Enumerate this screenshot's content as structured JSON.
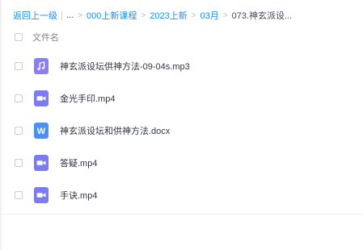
{
  "breadcrumb": {
    "back_label": "返回上一级",
    "ellipsis": "...",
    "items": [
      "000上新课程",
      "2023上新",
      "03月"
    ],
    "current": "073.神玄派设...",
    "arrow": ">"
  },
  "table": {
    "header": {
      "name_column": "文件名"
    },
    "files": [
      {
        "name": "神玄派设坛供神方法-09-04s.mp3",
        "type": "audio"
      },
      {
        "name": "金光手印.mp4",
        "type": "video"
      },
      {
        "name": "神玄派设坛和供神方法.docx",
        "type": "word",
        "icon_letter": "W"
      },
      {
        "name": "答疑.mp4",
        "type": "video"
      },
      {
        "name": "手诀.mp4",
        "type": "video"
      }
    ]
  },
  "colors": {
    "link": "#1890ff",
    "audio_icon": "#8a7ef0",
    "video_icon": "#7b7cf3",
    "word_icon": "#4a90f5"
  },
  "icons": {
    "audio": "music-note-icon",
    "video": "video-camera-icon",
    "word": "word-document-icon"
  }
}
